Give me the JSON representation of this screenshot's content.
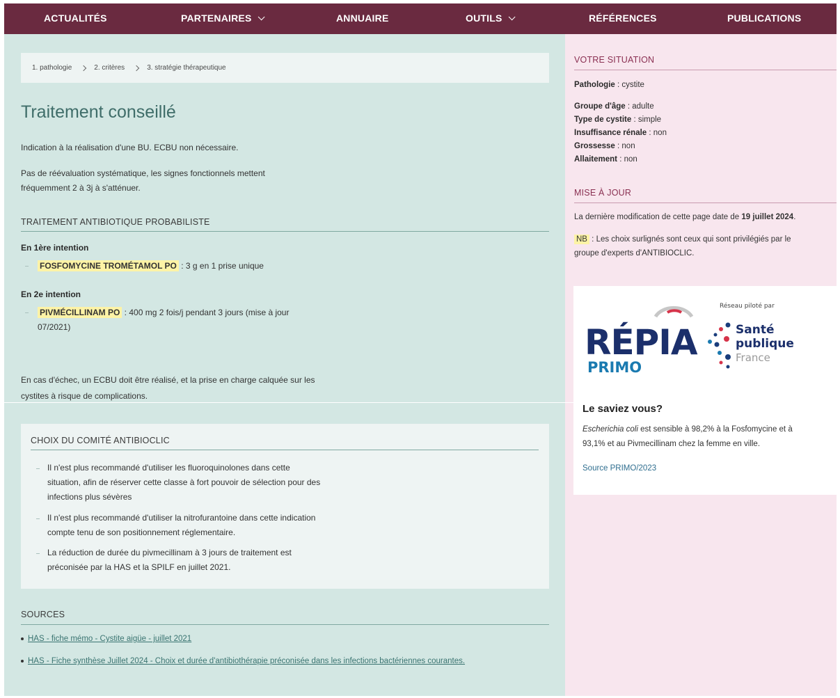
{
  "nav": {
    "items": [
      {
        "label": "ACTUALITÉS",
        "dropdown": false
      },
      {
        "label": "PARTENAIRES",
        "dropdown": true
      },
      {
        "label": "ANNUAIRE",
        "dropdown": false
      },
      {
        "label": "OUTILS",
        "dropdown": true
      },
      {
        "label": "RÉFÉRENCES",
        "dropdown": false
      },
      {
        "label": "PUBLICATIONS",
        "dropdown": false
      }
    ]
  },
  "breadcrumb": {
    "step1": "1. pathologie",
    "step2": "2. critères",
    "step3": "3. stratégie thérapeutique"
  },
  "main": {
    "title": "Traitement conseillé",
    "intro1": "Indication à la réalisation d'une BU. ECBU non nécessaire.",
    "intro2_line1": "Pas de réévaluation systématique, les signes fonctionnels mettent",
    "intro2_line2": "fréquemment 2 à 3j à s'atténuer.",
    "antibio_heading": "TRAITEMENT ANTIBIOTIQUE PROBABILISTE",
    "first_label": "En 1ère intention",
    "first_drug": "FOSFOMYCINE TROMÉTAMOL   PO",
    "first_dose": " : 3 g en 1 prise unique",
    "second_label": "En 2e intention",
    "second_drug": "PIVMÉCILLINAM PO",
    "second_dose_line1": " : 400 mg 2 fois/j pendant 3 jours (mise à jour",
    "second_dose_line2": "07/2021)",
    "failure_line1": "En cas d'échec, un ECBU doit être réalisé, et la prise en charge calquée sur les",
    "failure_line2": "cystites à risque de complications."
  },
  "choix": {
    "heading": "CHOIX DU COMITÉ ANTIBIOCLIC",
    "items": [
      {
        "l1": "Il n'est plus recommandé d'utiliser les fluoroquinolones dans cette",
        "l2": "situation, afin de réserver cette classe à fort pouvoir de sélection pour des",
        "l3": "infections plus sévères"
      },
      {
        "l1": "Il n'est plus recommandé d'utiliser la nitrofurantoine dans cette indication",
        "l2": "compte tenu de son positionnement réglementaire."
      },
      {
        "l1": "La réduction de durée du pivmecillinam à 3 jours de traitement est",
        "l2": "préconisée par la HAS et la SPILF en juillet 2021."
      }
    ]
  },
  "sources": {
    "heading": "SOURCES",
    "links": [
      "HAS - fiche mémo - Cystite aigüe - juillet 2021",
      "HAS - Fiche synthèse Juillet 2024 - Choix et durée d'antibiothérapie préconisée dans les infections bactériennes courantes."
    ]
  },
  "situation": {
    "heading": "VOTRE SITUATION",
    "pathologie_label": "Pathologie",
    "pathologie_value": " : cystite",
    "age_label": "Groupe d'âge",
    "age_value": " : adulte",
    "type_label": "Type de cystite",
    "type_value": " : simple",
    "ir_label": "Insuffisance rénale",
    "ir_value": " : non",
    "grossesse_label": "Grossesse",
    "grossesse_value": " : non",
    "allaitement_label": "Allaitement",
    "allaitement_value": " : non"
  },
  "update": {
    "heading": "MISE À JOUR",
    "text_prefix": "La dernière modification de cette page date de ",
    "date": "19 juillet 2024",
    "text_suffix": ".",
    "nb_label": "NB",
    "nb_text_line1": " : Les choix surlignés sont ceux qui sont privilégiés par le",
    "nb_text_line2": "groupe d'experts d'ANTIBIOCLIC."
  },
  "card": {
    "reseau_label": "Réseau piloté par",
    "repia_text": "RÉPIA",
    "primo_text": "PRIMO",
    "sante_l1": "Santé",
    "sante_l2": "publique",
    "sante_l3": "France",
    "title": "Le saviez vous?",
    "text_italic": "Escherichia coli",
    "text_line1": " est sensible à 98,2% à la Fosfomycine et à",
    "text_line2": "93,1% et au Pivmecillinam chez la femme en ville.",
    "link": "Source PRIMO/2023"
  },
  "colors": {
    "nav_bg": "#6a2a40",
    "left_bg": "#d3e7e3",
    "right_bg": "#f8e6ee",
    "title_color": "#3f6d69",
    "highlight": "#fdf3a6",
    "right_heading": "#8a3052"
  }
}
